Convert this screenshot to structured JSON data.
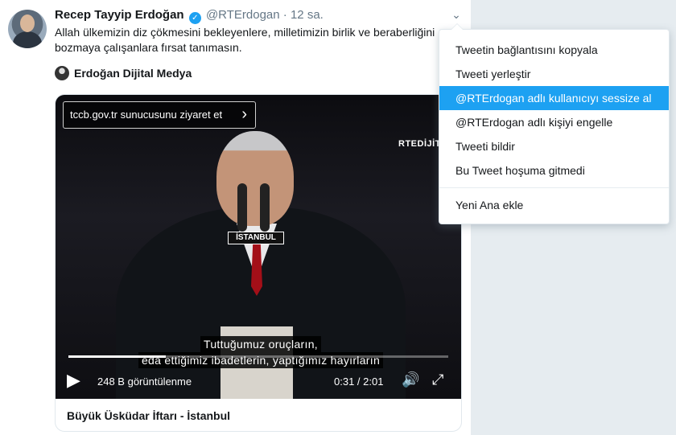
{
  "tweet": {
    "author_name": "Recep Tayyip Erdoğan",
    "verified_symbol": "✓",
    "handle": "@RTErdogan",
    "separator": "·",
    "time": "12 sa.",
    "text": "Allah ülkemizin diz çökmesini bekleyenlere, milletimizin birlik ve beraberliğini bozmaya çalışanlara fırsat tanımasın.",
    "source_name": "Erdoğan Dijital Medya"
  },
  "video": {
    "visit_link": "tccb.gov.tr sunucusunu ziyaret et",
    "logo_text": "RTEDİJİTAL",
    "location_tag": "İSTANBUL",
    "subtitle_line1": "Tuttuğumuz oruçların,",
    "subtitle_line2": "eda ettiğimiz ibadetlerin, yaptığımız hayırların",
    "views": "248 B görüntülenme",
    "time_readout": "0:31 / 2:01",
    "progress_fraction": 0.256
  },
  "card": {
    "title": "Büyük Üsküdar İftarı - İstanbul"
  },
  "menu": {
    "items": [
      "Tweetin bağlantısını kopyala",
      "Tweeti yerleştir",
      "@RTErdogan adlı kullanıcıyı sessize al",
      "@RTErdogan adlı kişiyi engelle",
      "Tweeti bildir",
      "Bu Tweet hoşuma gitmedi",
      "Yeni Ana ekle"
    ],
    "active_index": 2
  },
  "colors": {
    "accent": "#1da1f2",
    "text": "#14171a",
    "muted": "#657786"
  },
  "icons": {
    "caret": "chevron-down-icon",
    "play": "play-icon",
    "volume": "volume-icon",
    "fullscreen": "fullscreen-icon",
    "verified": "verified-badge-icon"
  }
}
